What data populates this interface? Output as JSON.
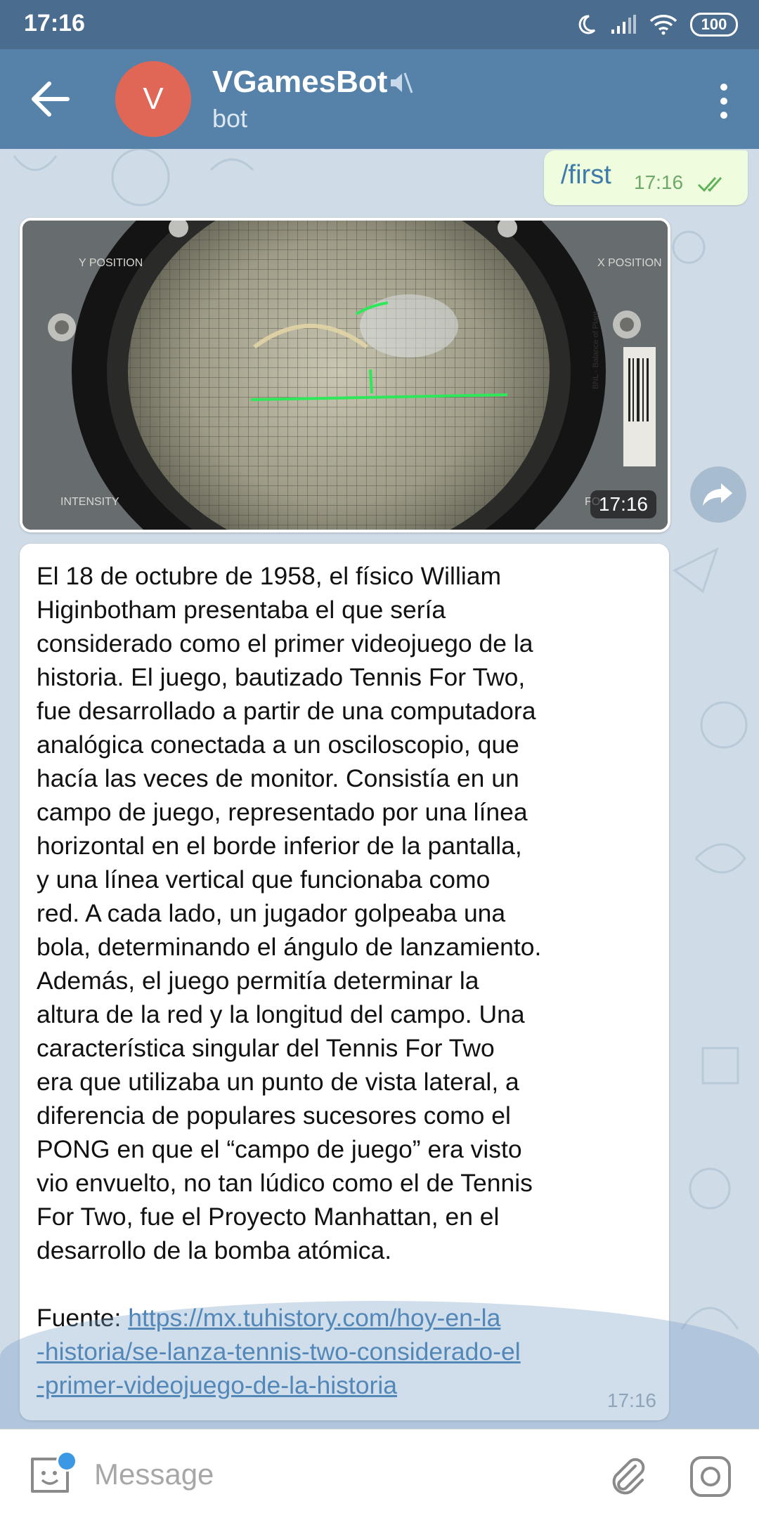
{
  "status_bar": {
    "time": "17:16",
    "battery": "100"
  },
  "header": {
    "title": "VGamesBot",
    "subtitle": "bot",
    "avatar_letter": "V"
  },
  "outgoing": {
    "text": "/first",
    "time": "17:16"
  },
  "photo": {
    "time": "17:16",
    "labels": {
      "y_position": "Y POSITION",
      "x_position": "X POSITION",
      "intensity": "INTENSITY",
      "focus": "FO",
      "tag": "BNL - Balance of Plant"
    }
  },
  "message": {
    "text": "El 18 de octubre de 1958, el físico William\nHiginbotham presentaba el que sería\nconsiderado como el primer videojuego de la\nhistoria. El juego, bautizado Tennis For Two,\nfue desarrollado a partir de una computadora\nanalógica conectada a un osciloscopio, que\nhacía las veces de monitor. Consistía en un\ncampo de juego, representado por una línea\nhorizontal en el borde inferior de la pantalla,\ny una línea vertical que funcionaba como\nred. A cada lado, un jugador golpeaba una\nbola, determinando el ángulo de lanzamiento.\nAdemás, el juego permitía determinar la\naltura de la red y la longitud del campo. Una\ncaracterística singular del Tennis For Two\nera que utilizaba un punto de vista lateral, a\ndiferencia de populares sucesores como el\nPONG en que el “campo de juego” era visto\nvio envuelto, no tan lúdico como el de Tennis\nFor Two, fue el Proyecto Manhattan, en el\ndesarrollo de la bomba atómica.",
    "source_label": "Fuente: ",
    "source_url": "https://mx.tuhistory.com/hoy-en-la-historia/se-lanza-tennis-two-considerado-el-primer-videojuego-de-la-historia",
    "source_url_display": "https://mx.tuhistory.com/hoy-en-la\n-historia/se-lanza-tennis-two-considerado-el\n-primer-videojuego-de-la-historia",
    "time": "17:16"
  },
  "input": {
    "placeholder": "Message"
  },
  "colors": {
    "header": "#5682a9",
    "status_bar": "#4a6c8f",
    "avatar": "#e06756",
    "link": "#3e7ab0",
    "outgoing_bubble": "#effdde"
  }
}
